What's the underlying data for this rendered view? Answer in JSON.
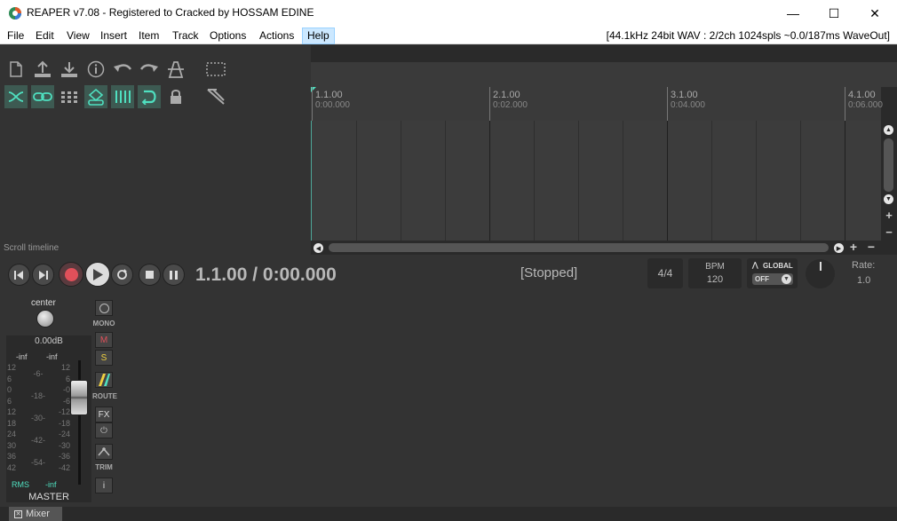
{
  "window": {
    "title": "REAPER v7.08 - Registered to Cracked by HOSSAM EDINE",
    "minimize_glyph": "—",
    "maximize_glyph": "☐",
    "close_glyph": "✕"
  },
  "menubar": {
    "items": [
      "File",
      "Edit",
      "View",
      "Insert",
      "Item",
      "Track",
      "Options",
      "Actions",
      "Help"
    ],
    "active": "Help",
    "audio_status": "[44.1kHz 24bit WAV : 2/2ch 1024spls ~0.0/187ms WaveOut]"
  },
  "toolbar": {
    "row1_icons": [
      "new-project-icon",
      "open-project-icon",
      "save-project-icon",
      "project-info-icon",
      "undo-icon",
      "redo-icon",
      "metronome-icon"
    ],
    "row2_icons": [
      "ripple-edit-icon",
      "link-icon",
      "grid-icon",
      "group-icon",
      "snap-grid-icon",
      "loop-icon",
      "lock-icon"
    ],
    "scroll_label": "Scroll timeline"
  },
  "ruler": {
    "marks": [
      {
        "bar": "1.1.00",
        "time": "0:00.000"
      },
      {
        "bar": "2.1.00",
        "time": "0:02.000"
      },
      {
        "bar": "3.1.00",
        "time": "0:04.000"
      },
      {
        "bar": "4.1.00",
        "time": "0:06.000"
      }
    ]
  },
  "transport": {
    "time": "1.1.00 / 0:00.000",
    "state": "[Stopped]",
    "time_signature": "4/4",
    "bpm_label": "BPM",
    "bpm_value": "120",
    "global_label": "GLOBAL",
    "global_value": "OFF",
    "rate_label": "Rate:",
    "rate_value": "1.0",
    "record_color": "#e0505a",
    "accent": "#4fe0c0"
  },
  "master": {
    "pan_label": "center",
    "volume": "0.00dB",
    "peak_left": "-inf",
    "peak_right": "-inf",
    "scale_left": [
      "12",
      "6",
      "0",
      "6",
      "12",
      "18",
      "24",
      "30",
      "36",
      "42"
    ],
    "scale_middle": [
      "-6-",
      "-18-",
      "-30-",
      "-42-",
      "-54-"
    ],
    "scale_right": [
      "12",
      "6",
      "-0",
      "-6",
      "-12",
      "-18",
      "-24",
      "-30",
      "-36",
      "-42"
    ],
    "rms_label": "RMS",
    "rms_value": "-inf",
    "name": "MASTER",
    "mono_label": "MONO",
    "mute_label": "M",
    "solo_label": "S",
    "route_label": "ROUTE",
    "fx_label": "FX",
    "trim_label": "TRIM",
    "info_label": "i"
  },
  "tabs": {
    "mixer": "Mixer"
  }
}
